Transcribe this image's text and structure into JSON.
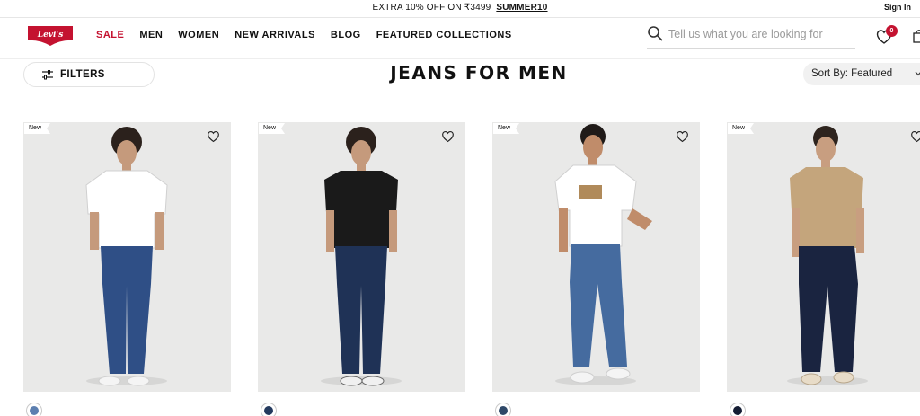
{
  "promo": {
    "text": "EXTRA 10% OFF ON ₹3499",
    "code": "SUMMER10",
    "sign_in": "Sign In"
  },
  "header": {
    "logo_text": "Levi's",
    "nav": [
      "SALE",
      "MEN",
      "WOMEN",
      "NEW ARRIVALS",
      "BLOG",
      "FEATURED COLLECTIONS"
    ],
    "search_placeholder": "Tell us what you are looking for",
    "wishlist_count": "0"
  },
  "toolbar": {
    "filters_label": "FILTERS",
    "page_title": "JEANS FOR MEN",
    "sort_label": "Sort By: Featured"
  },
  "products": [
    {
      "badge": "New",
      "shirt_color": "#ffffff",
      "jeans_color": "#2f4f86",
      "swatch_color": "#5c7fb0"
    },
    {
      "badge": "New",
      "shirt_color": "#1a1a1a",
      "jeans_color": "#1f3256",
      "swatch_color": "#243a5e"
    },
    {
      "badge": "New",
      "shirt_color": "#ffffff",
      "jeans_color": "#456b9f",
      "swatch_color": "#2f4868"
    },
    {
      "badge": "New",
      "shirt_color": "#c4a57c",
      "jeans_color": "#1a2440",
      "swatch_color": "#141c33"
    }
  ],
  "colors": {
    "brand_red": "#c41230",
    "text": "#111111",
    "card_bg": "#ebebeb"
  }
}
